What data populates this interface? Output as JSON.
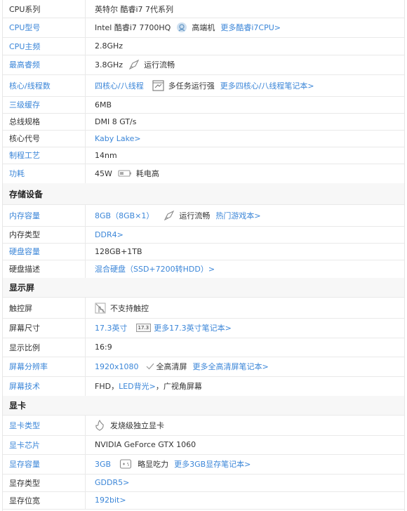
{
  "cpu": {
    "series": {
      "label": "CPU系列",
      "value": "英特尔 酷睿i7 7代系列"
    },
    "model": {
      "label": "CPU型号",
      "value": "Intel 酷睿i7 7700HQ",
      "tag": "高端机",
      "link": "更多酷睿i7CPU>"
    },
    "freq": {
      "label": "CPU主频",
      "value": "2.8GHz"
    },
    "turbo": {
      "label": "最高睿频",
      "value": "3.8GHz",
      "tag": "运行流畅"
    },
    "cores": {
      "label": "核心/线程数",
      "value": "四核心/八线程",
      "tag": "多任务运行强",
      "link": "更多四核心/八线程笔记本>"
    },
    "cache": {
      "label": "三级缓存",
      "value": "6MB"
    },
    "bus": {
      "label": "总线规格",
      "value": "DMI 8 GT/s"
    },
    "codename": {
      "label": "核心代号",
      "value": "Kaby Lake>"
    },
    "process": {
      "label": "制程工艺",
      "value": "14nm"
    },
    "power": {
      "label": "功耗",
      "value": "45W",
      "tag": "耗电高"
    }
  },
  "storage": {
    "title": "存储设备",
    "capacity": {
      "label": "内存容量",
      "value": "8GB（8GB×1）",
      "tag": "运行流畅",
      "link": "热门游戏本>"
    },
    "type": {
      "label": "内存类型",
      "value": "DDR4>"
    },
    "disk": {
      "label": "硬盘容量",
      "value": "128GB+1TB"
    },
    "desc": {
      "label": "硬盘描述",
      "value": "混合硬盘（SSD+7200转HDD）>"
    }
  },
  "display": {
    "title": "显示屏",
    "touch": {
      "label": "触控屏",
      "tag": "不支持触控"
    },
    "size": {
      "label": "屏幕尺寸",
      "value": "17.3英寸",
      "badge": "17.3",
      "link": "更多17.3英寸笔记本>"
    },
    "ratio": {
      "label": "显示比例",
      "value": "16:9"
    },
    "resolution": {
      "label": "屏幕分辨率",
      "value": "1920x1080",
      "tag": "全高清屏",
      "link": "更多全高清屏笔记本>"
    },
    "tech": {
      "label": "屏幕技术",
      "prefix": "FHD，",
      "link": "LED背光>",
      "suffix": "，广视角屏幕"
    }
  },
  "gpu": {
    "title": "显卡",
    "type": {
      "label": "显卡类型",
      "tag": "发烧级独立显卡"
    },
    "chip": {
      "label": "显卡芯片",
      "value": "NVIDIA GeForce GTX 1060"
    },
    "vram": {
      "label": "显存容量",
      "value": "3GB",
      "tag": "略显吃力",
      "link": "更多3GB显存笔记本>"
    },
    "vramtype": {
      "label": "显存类型",
      "value": "GDDR5>"
    },
    "width": {
      "label": "显存位宽",
      "value": "192bit>"
    }
  }
}
